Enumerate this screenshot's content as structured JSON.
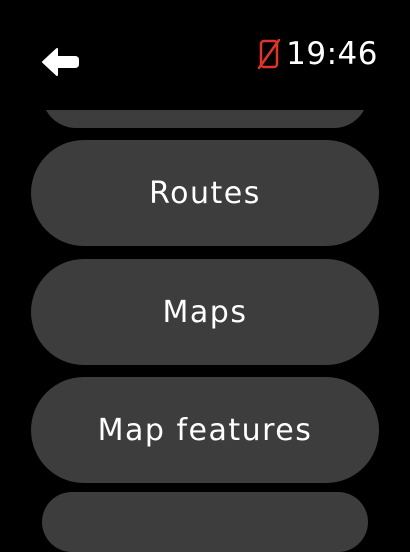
{
  "status": {
    "time": "19:46",
    "connection_icon": "phone-disconnected-icon",
    "connection_color": "#e0342b"
  },
  "nav": {
    "back_icon": "back-arrow-icon"
  },
  "menu": {
    "items": [
      {
        "label": "Routes"
      },
      {
        "label": "Maps"
      },
      {
        "label": "Map features"
      }
    ]
  },
  "colors": {
    "background": "#000000",
    "pill": "#3d3d3d",
    "text": "#ffffff"
  }
}
